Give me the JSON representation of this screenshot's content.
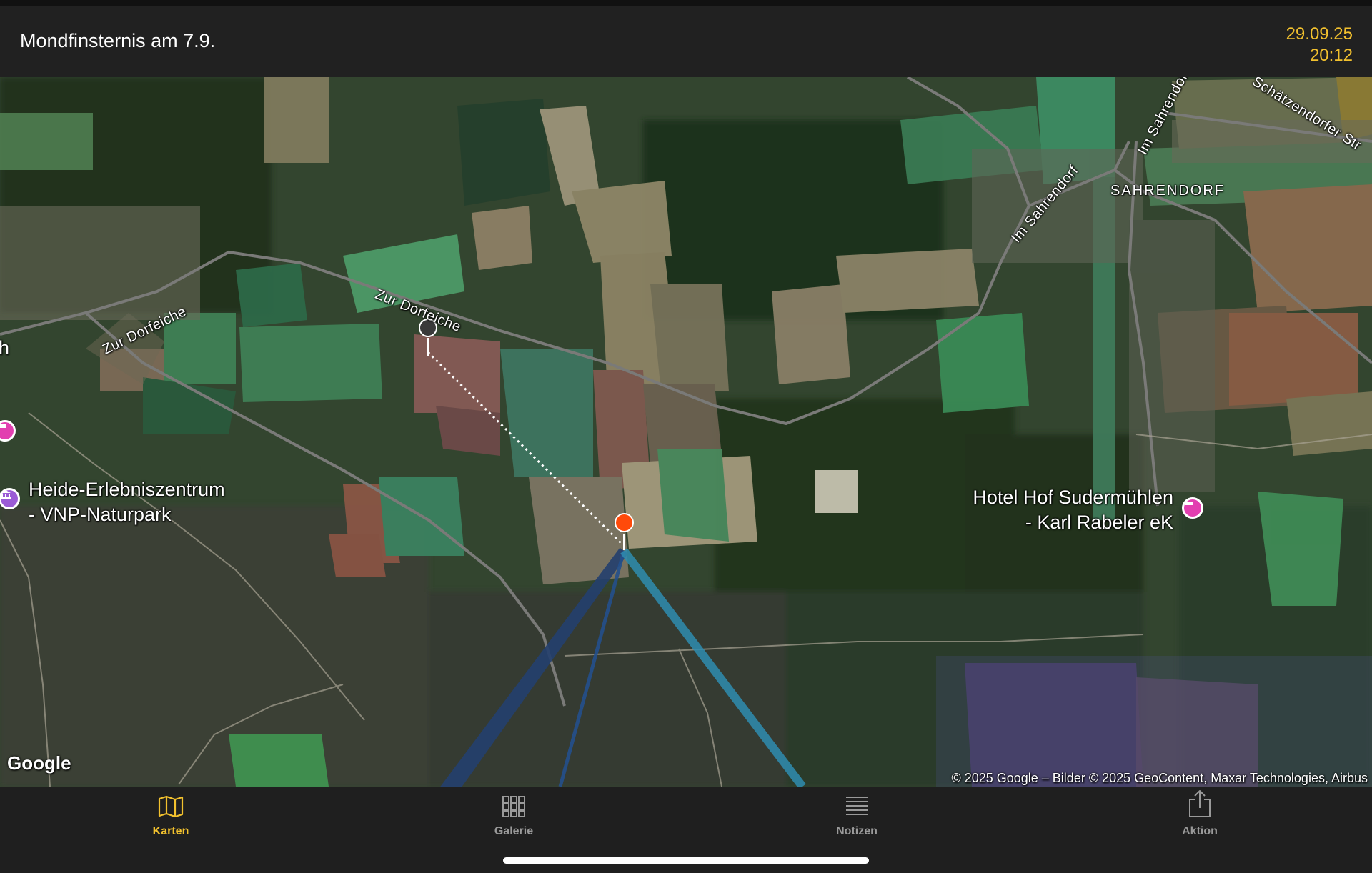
{
  "header": {
    "title": "Mondfinsternis am 7.9.",
    "date": "29.09.25",
    "time": "20:12"
  },
  "map": {
    "type": "satellite",
    "streets": [
      "Zur Dorfeiche",
      "Zur Dorfeiche",
      "Im Sahrendorf",
      "Im Sahrendorf",
      "Schätzendorfer Str"
    ],
    "town": "SAHRENDORF",
    "pois": [
      {
        "name_line1": "Heide-Erlebniszentrum",
        "name_line2": "- VNP-Naturpark",
        "icon": "museum-icon"
      },
      {
        "name_line1": "Hotel Hof Sudermühlen",
        "name_line2": "- Karl Rabeler eK",
        "icon": "hotel-icon"
      }
    ],
    "edge_label": "h",
    "logo": "Google",
    "copyright": "© 2025 Google – Bilder © 2025 GeoContent, Maxar Technologies, Airbus",
    "colors": {
      "observer_marker": "#ff4a0a",
      "reference_marker": "#3a3a3a",
      "ray_dark": "#24406e",
      "ray_light": "#2f8db0",
      "poi_pin": "#e23fb0"
    }
  },
  "tabs": [
    {
      "label": "Karten",
      "icon": "map-icon",
      "active": true
    },
    {
      "label": "Galerie",
      "icon": "grid-icon",
      "active": false
    },
    {
      "label": "Notizen",
      "icon": "notes-icon",
      "active": false
    },
    {
      "label": "Aktion",
      "icon": "share-icon",
      "active": false
    }
  ],
  "theme": {
    "accent": "#f2c12e",
    "bar_background": "#212121",
    "inactive_tab": "#9a9a9a"
  }
}
